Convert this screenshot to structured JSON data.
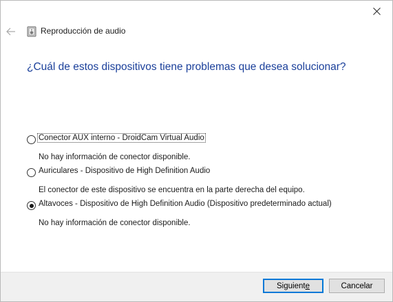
{
  "window": {
    "close_symbol": "✕"
  },
  "header": {
    "back_icon": "arrow-left-icon",
    "app_icon": "audio-playback-icon",
    "title": "Reproducción de audio"
  },
  "question": "¿Cuál de estos dispositivos tiene problemas que desea solucionar?",
  "devices": [
    {
      "label": "Conector AUX interno - DroidCam Virtual Audio",
      "description": "No hay información de conector disponible.",
      "selected": false
    },
    {
      "label": "Auriculares - Dispositivo de High Definition Audio",
      "description": "El conector de este dispositivo se encuentra en la parte derecha del equipo.",
      "selected": false
    },
    {
      "label": "Altavoces - Dispositivo de High Definition Audio (Dispositivo predeterminado actual)",
      "description": "No hay información de conector disponible.",
      "selected": true
    }
  ],
  "footer": {
    "next_label_pre": "Siguient",
    "next_label_accel": "e",
    "cancel_label": "Cancelar"
  },
  "colors": {
    "question": "#1a3f9a",
    "footer_bg": "#f0f0f0",
    "default_button_border": "#0078d7"
  }
}
